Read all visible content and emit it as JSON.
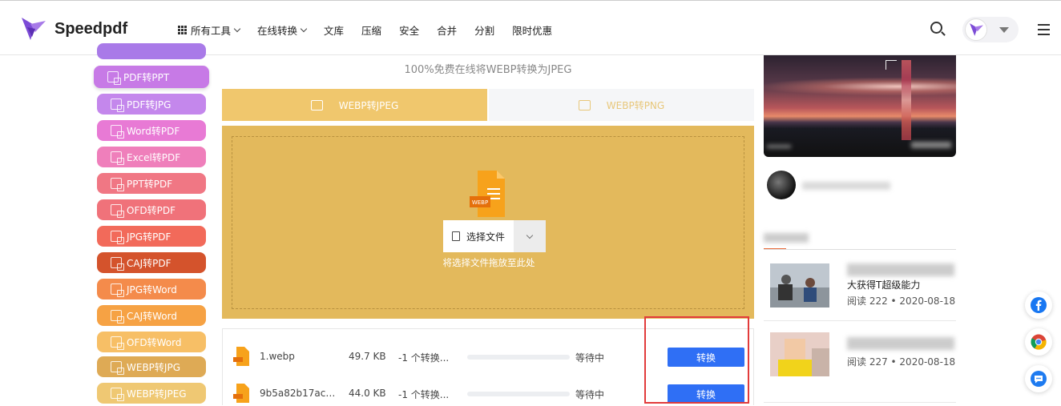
{
  "brand": {
    "name": "Speedpdf"
  },
  "nav": {
    "items": [
      "所有工具",
      "在线转换",
      "文库",
      "压缩",
      "安全",
      "合并",
      "分割",
      "限时优惠"
    ]
  },
  "sidebar": {
    "items": [
      {
        "label": "PDF转PPT",
        "color": "#c77ae6",
        "active": true
      },
      {
        "label": "PDF转JPG",
        "color": "#c487ec"
      },
      {
        "label": "Word转PDF",
        "color": "#e87ad5"
      },
      {
        "label": "Excel转PDF",
        "color": "#ef7fbb"
      },
      {
        "label": "PPT转PDF",
        "color": "#f07784"
      },
      {
        "label": "OFD转PDF",
        "color": "#f0727a"
      },
      {
        "label": "JPG转PDF",
        "color": "#f26a5a"
      },
      {
        "label": "CAJ转PDF",
        "color": "#d4532c"
      },
      {
        "label": "JPG转Word",
        "color": "#f48b4b"
      },
      {
        "label": "CAJ转Word",
        "color": "#f6a244"
      },
      {
        "label": "OFD转Word",
        "color": "#f7bf66"
      },
      {
        "label": "WEBP转JPG",
        "color": "#deaa55"
      },
      {
        "label": "WEBP转JPEG",
        "color": "#efc873"
      }
    ]
  },
  "main": {
    "subtitle": "100%免费在线将WEBP转换为JPEG",
    "tabs": [
      {
        "label": "WEBP转JPEG",
        "active": true
      },
      {
        "label": "WEBP转PNG",
        "active": false
      }
    ],
    "upload": {
      "file_badge": "WEBP",
      "choose_label": "选择文件",
      "hint": "将选择文件拖放至此处"
    },
    "files": [
      {
        "name": "1.webp",
        "size": "49.7 KB",
        "status": "-1 个转换...",
        "state": "等待中",
        "action": "转换",
        "progress": 0
      },
      {
        "name": "9b5a82b17ac6...",
        "size": "44.0 KB",
        "status": "-1 个转换...",
        "state": "等待中",
        "action": "转换",
        "progress": 0
      }
    ]
  },
  "right": {
    "articles": [
      {
        "title": "大获得T超级能力",
        "meta": "阅读 222 • 2020-08-18"
      },
      {
        "meta": "阅读 227 • 2020-08-18"
      }
    ]
  },
  "colors": {
    "accent_yellow": "#f0c76d",
    "drop_bg": "#e3b95c",
    "button_blue": "#2f6ff5",
    "highlight_red": "#e23b3b"
  },
  "icons": [
    "search-icon",
    "menu-icon",
    "facebook-icon",
    "chrome-icon",
    "chat-icon",
    "webp-file-icon"
  ]
}
